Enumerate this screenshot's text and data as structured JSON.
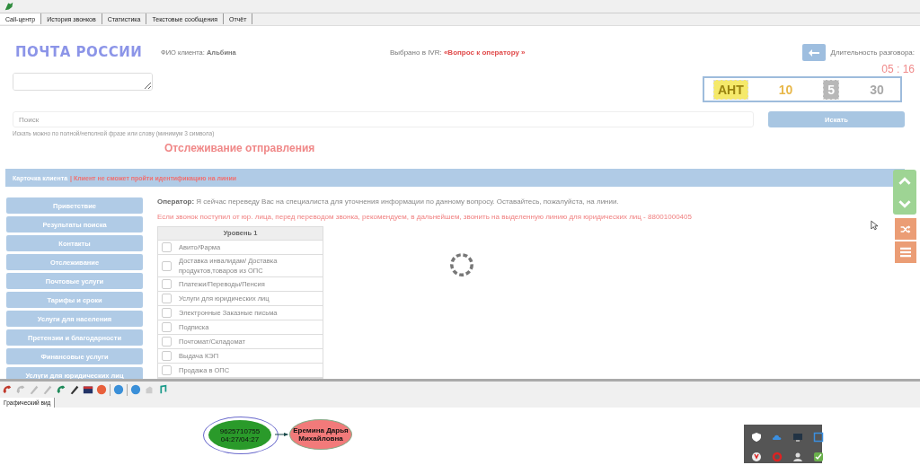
{
  "tabs": [
    {
      "label": "Call-центр",
      "selected": true
    },
    {
      "label": "История звонков",
      "selected": false
    },
    {
      "label": "Статистика",
      "selected": false
    },
    {
      "label": "Текстовые сообщения",
      "selected": false
    },
    {
      "label": "Отчёт",
      "selected": false
    }
  ],
  "logo": "ПОЧТА РОССИИ",
  "client": {
    "label": "ФИО клиента:",
    "name": "Альбина"
  },
  "ivr": {
    "label": "Выбрано в IVR:",
    "value": "«Вопрос к оператору »"
  },
  "duration": {
    "label": "Длительность разговора:",
    "value": "05 : 16"
  },
  "counters": [
    {
      "text": "АНТ",
      "kind": "stamp",
      "color": "#f5e96a"
    },
    {
      "text": "10",
      "kind": "plain",
      "color": "#e8b84a"
    },
    {
      "text": "5",
      "kind": "stamp",
      "color": "#b8b8b8"
    },
    {
      "text": "30",
      "kind": "plain",
      "color": "#a8a8a8"
    }
  ],
  "search": {
    "placeholder": "Поиск",
    "button": "Искать",
    "hint": "Искать можно по полной/неполной фразе или слову (минимум 3 символа)"
  },
  "section_title": "Отслеживание отправления",
  "card_bar": {
    "label": "Карточка клиента",
    "warning": "| Клиент не сможет пройти идентификацию на линии"
  },
  "nav": [
    {
      "label": "Приветствие"
    },
    {
      "label": "Результаты поиска"
    },
    {
      "label": "Контакты"
    },
    {
      "label": "Отслеживание"
    },
    {
      "label": "Почтовые услуги"
    },
    {
      "label": "Тарифы и сроки"
    },
    {
      "label": "Услуги для населения"
    },
    {
      "label": "Претензии и благодарности"
    },
    {
      "label": "Финансовые услуги"
    },
    {
      "label": "Услуги для юридических лиц"
    }
  ],
  "operator_text": "**Оператор:** Я сейчас переведу Вас на специалиста для уточнения информации по данному вопросу. Оставайтесь, пожалуйста, на линии.",
  "notice": "Если звонок поступил от юр. лица, перед переводом звонка, рекомендуем, в дальнейшем, звонить на выделенную линию для юридических лиц - 88001000405",
  "level_table": {
    "heading": "Уровень 1",
    "rows": [
      {
        "label": "Авито/Фарма",
        "checked": false
      },
      {
        "label": "Доставка инвалидам/ Доставка продуктов,товаров из ОПС",
        "checked": false
      },
      {
        "label": "Платежи/Переводы/Пенсия",
        "checked": false
      },
      {
        "label": "Услуги для юридических лиц",
        "checked": false
      },
      {
        "label": "Электронные Заказные письма",
        "checked": false
      },
      {
        "label": "Подписка",
        "checked": false
      },
      {
        "label": "Почтомат/Складомат",
        "checked": false
      },
      {
        "label": "Выдача КЭП",
        "checked": false
      },
      {
        "label": "Продажа в ОПС",
        "checked": false
      }
    ]
  },
  "bottom_tab": {
    "label": "Графический вид",
    "selected": true
  },
  "graph": {
    "caller": {
      "number": "9625710755",
      "time": "04:27/04:27"
    },
    "callee": {
      "name": "Еремина Дарья Михайловна"
    }
  }
}
